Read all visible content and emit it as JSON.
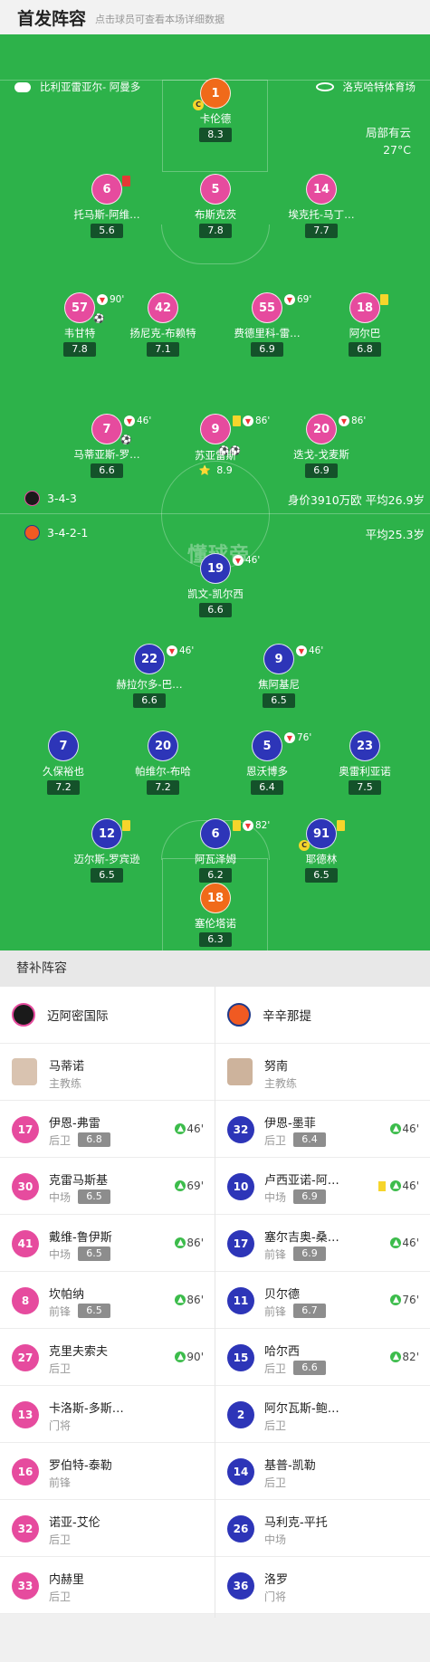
{
  "header": {
    "title": "首发阵容",
    "subtitle": "点击球员可查看本场详细数据"
  },
  "pitch": {
    "home_team": "比利亚雷亚尔- 阿曼多",
    "venue": "洛克哈特体育场",
    "weather": "局部有云",
    "temp": "27°C",
    "watermark": "懂球帝",
    "home_formation": "3-4-3",
    "home_info": "身价3910万欧 平均26.9岁",
    "away_formation": "3-4-2-1",
    "away_info": "平均25.3岁"
  },
  "home_players": [
    {
      "num": "1",
      "name": "卡伦德",
      "rating": "8.3",
      "captain": "C"
    },
    {
      "num": "6",
      "name": "托马斯-阿维…",
      "rating": "5.6"
    },
    {
      "num": "5",
      "name": "布斯克茨",
      "rating": "7.8"
    },
    {
      "num": "14",
      "name": "埃克托-马丁…",
      "rating": "7.7"
    },
    {
      "num": "57",
      "name": "韦甘特",
      "rating": "7.8",
      "minute": "90'"
    },
    {
      "num": "42",
      "name": "扬尼克-布赖特",
      "rating": "7.1"
    },
    {
      "num": "55",
      "name": "费德里科-雷…",
      "rating": "6.9",
      "minute": "69'"
    },
    {
      "num": "18",
      "name": "阿尔巴",
      "rating": "6.8"
    },
    {
      "num": "7",
      "name": "马蒂亚斯-罗…",
      "rating": "6.6",
      "minute": "46'"
    },
    {
      "num": "9",
      "name": "苏亚雷斯",
      "rating": "8.9",
      "minute": "86'",
      "star": "⭐"
    },
    {
      "num": "20",
      "name": "迭戈-戈麦斯",
      "rating": "6.9",
      "minute": "86'"
    }
  ],
  "away_players": [
    {
      "num": "19",
      "name": "凯文-凯尔西",
      "rating": "6.6",
      "minute": "46'"
    },
    {
      "num": "22",
      "name": "赫拉尔多-巴…",
      "rating": "6.6",
      "minute": "46'"
    },
    {
      "num": "9",
      "name": "焦阿基尼",
      "rating": "6.5",
      "minute": "46'"
    },
    {
      "num": "7",
      "name": "久保裕也",
      "rating": "7.2"
    },
    {
      "num": "20",
      "name": "帕维尔-布哈",
      "rating": "7.2"
    },
    {
      "num": "5",
      "name": "恩沃博多",
      "rating": "6.4",
      "minute": "76'"
    },
    {
      "num": "23",
      "name": "奥雷利亚诺",
      "rating": "7.5"
    },
    {
      "num": "12",
      "name": "迈尔斯-罗宾逊",
      "rating": "6.5"
    },
    {
      "num": "6",
      "name": "阿瓦泽姆",
      "rating": "6.2",
      "minute": "82'"
    },
    {
      "num": "91",
      "name": "耶德林",
      "rating": "6.5",
      "captain": "C"
    },
    {
      "num": "18",
      "name": "塞伦塔诺",
      "rating": "6.3"
    }
  ],
  "subs": {
    "title": "替补阵容",
    "home": {
      "team": "迈阿密国际",
      "coach": {
        "name": "马蒂诺",
        "role": "主教练"
      },
      "players": [
        {
          "num": "17",
          "name": "伊恩-弗雷",
          "pos": "后卫",
          "rating": "6.8",
          "minute": "46'"
        },
        {
          "num": "30",
          "name": "克雷马斯基",
          "pos": "中场",
          "rating": "6.5",
          "minute": "69'"
        },
        {
          "num": "41",
          "name": "戴维-鲁伊斯",
          "pos": "中场",
          "rating": "6.5",
          "minute": "86'"
        },
        {
          "num": "8",
          "name": "坎帕纳",
          "pos": "前锋",
          "rating": "6.5",
          "minute": "86'"
        },
        {
          "num": "27",
          "name": "克里夫索夫",
          "pos": "后卫",
          "minute": "90'"
        },
        {
          "num": "13",
          "name": "卡洛斯-多斯…",
          "pos": "门将"
        },
        {
          "num": "16",
          "name": "罗伯特-泰勒",
          "pos": "前锋"
        },
        {
          "num": "32",
          "name": "诺亚-艾伦",
          "pos": "后卫"
        },
        {
          "num": "33",
          "name": "内赫里",
          "pos": "后卫"
        }
      ]
    },
    "away": {
      "team": "辛辛那提",
      "coach": {
        "name": "努南",
        "role": "主教练"
      },
      "players": [
        {
          "num": "32",
          "name": "伊恩-墨菲",
          "pos": "后卫",
          "rating": "6.4",
          "minute": "46'"
        },
        {
          "num": "10",
          "name": "卢西亚诺-阿…",
          "pos": "中场",
          "rating": "6.9",
          "minute": "46'"
        },
        {
          "num": "17",
          "name": "塞尔吉奥-桑…",
          "pos": "前锋",
          "rating": "6.9",
          "minute": "46'"
        },
        {
          "num": "11",
          "name": "贝尔德",
          "pos": "前锋",
          "rating": "6.7",
          "minute": "76'"
        },
        {
          "num": "15",
          "name": "哈尔西",
          "pos": "后卫",
          "rating": "6.6",
          "minute": "82'"
        },
        {
          "num": "2",
          "name": "阿尔瓦斯-鲍…",
          "pos": "后卫"
        },
        {
          "num": "14",
          "name": "基普-凯勒",
          "pos": "后卫"
        },
        {
          "num": "26",
          "name": "马利克-平托",
          "pos": "中场"
        },
        {
          "num": "36",
          "name": "洛罗",
          "pos": "门将"
        }
      ]
    }
  },
  "colors": {
    "pitch": "#2db24a",
    "home": "#e64b9e",
    "away": "#2d35b8",
    "gk": "#f06a1a"
  }
}
